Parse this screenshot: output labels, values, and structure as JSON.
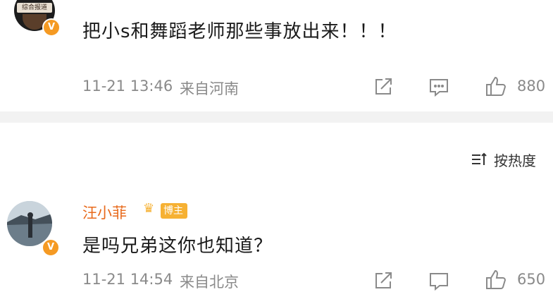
{
  "post": {
    "avatar_label": "综合报道",
    "badge": "V",
    "text": "把小s和舞蹈老师那些事放出来！！！",
    "time": "11-21 13:46",
    "location": "来自河南",
    "like_count": "880",
    "icons": [
      "share-icon",
      "comment-icon",
      "like-icon"
    ]
  },
  "sort": {
    "label": "按热度",
    "icon": "sort-icon"
  },
  "reply": {
    "username": "汪小菲",
    "badge_label": "博主",
    "verified_badge": "V",
    "text": "是吗兄弟这你也知道？",
    "time": "11-21 14:54",
    "location": "来自北京",
    "like_count": "650"
  },
  "colors": {
    "username": "#e86a1c",
    "badge": "#f6b133",
    "verified": "#f59a23",
    "meta": "#8a8a8a",
    "divider": "#f2f2f2"
  }
}
